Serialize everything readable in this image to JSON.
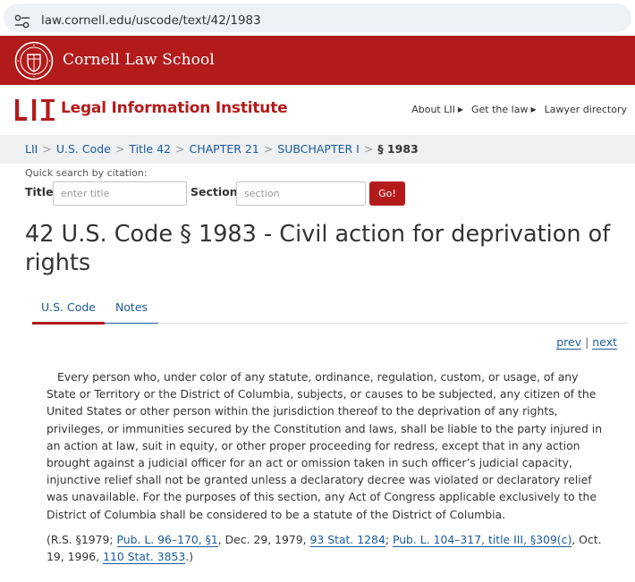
{
  "browser": {
    "url": "law.cornell.edu/uscode/text/42/1983"
  },
  "cornell": {
    "title": "Cornell Law School"
  },
  "lii": {
    "logo_text": "LII",
    "name": "Legal Information Institute",
    "nav": [
      "About LII",
      "Get the law",
      "Lawyer directory"
    ]
  },
  "breadcrumb": {
    "items": [
      "LII",
      "U.S. Code",
      "Title 42",
      "CHAPTER 21",
      "SUBCHAPTER I"
    ],
    "current": "§ 1983"
  },
  "quick_search": {
    "label": "Quick search by citation:",
    "title_label": "Title",
    "title_placeholder": "enter title",
    "section_label": "Section",
    "section_placeholder": "section",
    "go_label": "Go!"
  },
  "page": {
    "title": "42 U.S. Code § 1983 - Civil action for deprivation of rights"
  },
  "tabs": [
    {
      "label": "U.S. Code",
      "active": true
    },
    {
      "label": "Notes",
      "active": false
    }
  ],
  "pager": {
    "prev": "prev",
    "separator": "|",
    "next": "next"
  },
  "statute": {
    "text": "Every person who, under color of any statute, ordinance, regulation, custom, or usage, of any State or Territory or the District of Columbia, subjects, or causes to be subjected, any citizen of the United States or other person within the jurisdiction thereof to the deprivation of any rights, privileges, or immunities secured by the Constitution and laws, shall be liable to the party injured in an action at law, suit in equity, or other proper proceeding for redress, except that in any action brought against a judicial officer for an act or omission taken in such officer’s judicial capacity, injunctive relief shall not be granted unless a declaratory decree was violated or declaratory relief was unavailable. For the purposes of this section, any Act of Congress applicable exclusively to the District of Columbia shall be considered to be a statute of the District of Columbia."
  },
  "credits": {
    "prefix": "(R.S. §1979; ",
    "link1": "Pub. L. 96–170, §1",
    "mid1": ", Dec. 29, 1979, ",
    "link2": "93 Stat. 1284",
    "mid2": "; ",
    "link3": "Pub. L. 104–317, title III, §309(c)",
    "mid3": ", Oct. 19, 1996, ",
    "link4": "110 Stat. 3853",
    "suffix": ".)"
  },
  "colors": {
    "cornell_red": "#b31b1b",
    "link_blue": "#1a5a9c",
    "breadcrumb_bg": "#eef0f2"
  },
  "icons": {
    "site_settings": "tune-icon",
    "cornell_seal": "cornell-seal-icon"
  }
}
